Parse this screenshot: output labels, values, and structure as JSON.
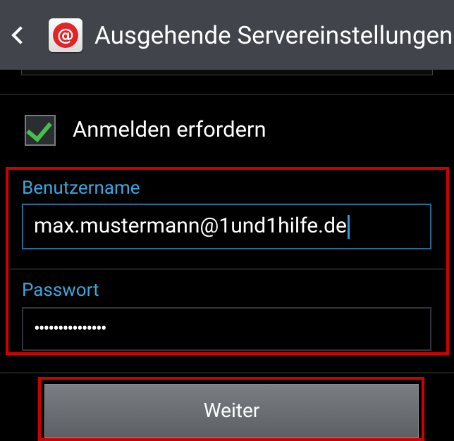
{
  "action_bar": {
    "title": "Ausgehende Servereinstellungen",
    "back_icon": "chevron-left-icon",
    "app_icon": "email-app-icon"
  },
  "login_required": {
    "label": "Anmelden erfordern",
    "checked": true
  },
  "username": {
    "label": "Benutzername",
    "value": "max.mustermann@1und1hilfe.de"
  },
  "password": {
    "label": "Passwort",
    "value": "•••••••••••••••"
  },
  "next_button": {
    "label": "Weiter"
  },
  "colors": {
    "action_bar": "#41454b",
    "label_accent": "#3aa7e0",
    "check": "#46c04b",
    "highlight": "#d00000"
  }
}
